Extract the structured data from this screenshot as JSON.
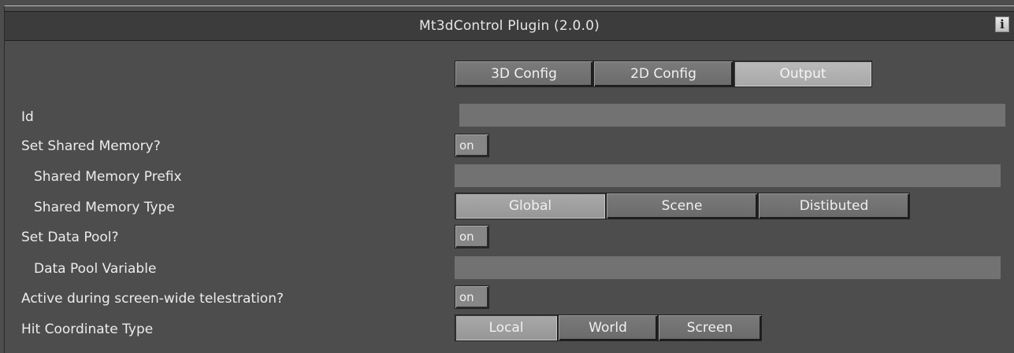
{
  "window": {
    "title": "Mt3dControl Plugin (2.0.0)",
    "info_icon_glyph": "i"
  },
  "tabs": [
    {
      "label": "3D Config",
      "selected": false
    },
    {
      "label": "2D Config",
      "selected": false
    },
    {
      "label": "Output",
      "selected": true
    }
  ],
  "fields": {
    "id": {
      "label": "Id",
      "value": ""
    },
    "set_shared_memory": {
      "label": "Set Shared Memory?",
      "value": "on"
    },
    "shared_memory_prefix": {
      "label": "Shared Memory Prefix",
      "value": ""
    },
    "shared_memory_type": {
      "label": "Shared Memory Type",
      "options": [
        "Global",
        "Scene",
        "Distibuted"
      ],
      "selected": "Global"
    },
    "set_data_pool": {
      "label": "Set Data Pool?",
      "value": "on"
    },
    "data_pool_variable": {
      "label": "Data Pool Variable",
      "value": ""
    },
    "active_telestration": {
      "label": "Active during screen-wide telestration?",
      "value": "on"
    },
    "hit_coordinate_type": {
      "label": "Hit Coordinate Type",
      "options": [
        "Local",
        "World",
        "Screen"
      ],
      "selected": "Local"
    }
  },
  "colors": {
    "panel_bg": "#4d4d4d",
    "titlebar_bg": "#3c3c3c",
    "field_bg": "#727272",
    "selected_button": "#a9a9a9",
    "unselected_button": "#737373"
  }
}
